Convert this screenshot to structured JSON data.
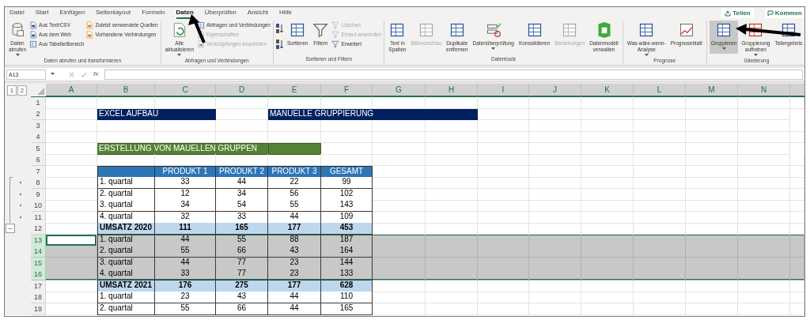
{
  "ribbon_tabs": [
    {
      "label": "Datei",
      "selected": false
    },
    {
      "label": "Start",
      "selected": false
    },
    {
      "label": "Einfügen",
      "selected": false
    },
    {
      "label": "Seitenlayout",
      "selected": false
    },
    {
      "label": "Formeln",
      "selected": false
    },
    {
      "label": "Daten",
      "selected": true
    },
    {
      "label": "Überprüfen",
      "selected": false
    },
    {
      "label": "Ansicht",
      "selected": false
    },
    {
      "label": "Hilfe",
      "selected": false
    }
  ],
  "share_button": "Teilen",
  "comments_button": "Kommen",
  "ribbon_groups": [
    {
      "label": "Daten abrufen und transformieren",
      "columns": [
        {
          "kind": "large",
          "label": "Daten\nabrufen",
          "dropdown": true,
          "disabled": false,
          "selected": false
        },
        {
          "kind": "stack",
          "items": [
            {
              "label": "Aus Text/CSV",
              "disabled": false
            },
            {
              "label": "Aus dem Web",
              "disabled": false
            },
            {
              "label": "Aus Tabelle/Bereich",
              "disabled": false
            }
          ]
        },
        {
          "kind": "stack",
          "items": [
            {
              "label": "Zuletzt verwendete Quellen",
              "disabled": false
            },
            {
              "label": "Vorhandene Verbindungen",
              "disabled": false
            }
          ]
        }
      ]
    },
    {
      "label": "Abfragen und Verbindungen",
      "columns": [
        {
          "kind": "large",
          "label": "Alle\naktualisieren",
          "dropdown": true,
          "disabled": false,
          "selected": false
        },
        {
          "kind": "stack",
          "items": [
            {
              "label": "Abfragen und Verbindungen",
              "disabled": false
            },
            {
              "label": "Eigenschaften",
              "disabled": true
            },
            {
              "label": "Verknüpfungen bearbeiten",
              "disabled": true
            }
          ]
        }
      ]
    },
    {
      "label": "Sortieren und Filtern",
      "columns": [
        {
          "kind": "sort_buttons"
        },
        {
          "kind": "large",
          "label": "Sortieren",
          "dropdown": false,
          "disabled": false,
          "selected": false
        },
        {
          "kind": "large",
          "label": "Filtern",
          "dropdown": false,
          "disabled": false,
          "selected": false
        },
        {
          "kind": "stack",
          "items": [
            {
              "label": "Löschen",
              "disabled": true
            },
            {
              "label": "Erneut anwenden",
              "disabled": true
            },
            {
              "label": "Erweitert",
              "disabled": false
            }
          ]
        }
      ]
    },
    {
      "label": "Datentools",
      "columns": [
        {
          "kind": "large",
          "label": "Text in\nSpalten",
          "dropdown": false,
          "disabled": false,
          "selected": false
        },
        {
          "kind": "large",
          "label": "Blitzvorschau",
          "dropdown": false,
          "disabled": true,
          "selected": false
        },
        {
          "kind": "large",
          "label": "Duplikate\nentfernen",
          "dropdown": false,
          "disabled": false,
          "selected": false
        },
        {
          "kind": "large",
          "label": "Datenüberprüfung",
          "dropdown": true,
          "disabled": false,
          "selected": false
        },
        {
          "kind": "large",
          "label": "Konsolidieren",
          "dropdown": false,
          "disabled": false,
          "selected": false
        },
        {
          "kind": "large",
          "label": "Beziehungen",
          "dropdown": false,
          "disabled": true,
          "selected": false
        },
        {
          "kind": "large",
          "label": "Datenmodell\nverwalten",
          "dropdown": false,
          "disabled": false,
          "selected": false
        }
      ]
    },
    {
      "label": "Prognose",
      "columns": [
        {
          "kind": "large",
          "label": "Was-wäre-wenn-\nAnalyse",
          "dropdown": true,
          "disabled": false,
          "selected": false
        },
        {
          "kind": "large",
          "label": "Prognoseblatt",
          "dropdown": false,
          "disabled": false,
          "selected": false
        }
      ]
    },
    {
      "label": "Gliederung",
      "columns": [
        {
          "kind": "large",
          "label": "Gruppieren",
          "dropdown": true,
          "disabled": false,
          "selected": true
        },
        {
          "kind": "large",
          "label": "Gruppierung\naufheben",
          "dropdown": true,
          "disabled": false,
          "selected": false
        },
        {
          "kind": "large",
          "label": "Teilergebnis",
          "dropdown": false,
          "disabled": false,
          "selected": false
        }
      ]
    }
  ],
  "name_box": "A13",
  "function_label": "fx",
  "outline_levels": [
    "1",
    "2"
  ],
  "columns": [
    {
      "label": "A",
      "selected": true
    },
    {
      "label": "B",
      "selected": true
    },
    {
      "label": "C",
      "selected": true
    },
    {
      "label": "D",
      "selected": true
    },
    {
      "label": "E",
      "selected": true
    },
    {
      "label": "F",
      "selected": true
    },
    {
      "label": "G",
      "selected": true
    },
    {
      "label": "H",
      "selected": true
    },
    {
      "label": "I",
      "selected": true
    },
    {
      "label": "J",
      "selected": true
    },
    {
      "label": "K",
      "selected": true
    },
    {
      "label": "L",
      "selected": true
    },
    {
      "label": "M",
      "selected": true
    },
    {
      "label": "N",
      "selected": true
    }
  ],
  "rows": [
    {
      "number": "1",
      "kind": "blank",
      "selected": false,
      "active": false,
      "grouped": false
    },
    {
      "number": "2",
      "kind": "banners",
      "selected": false,
      "active": false,
      "grouped": false,
      "banners": [
        "EXCEL AUFBAU",
        "MANUELLE GRUPPIERUNG"
      ]
    },
    {
      "number": "3",
      "kind": "blank",
      "selected": false,
      "active": false,
      "grouped": false
    },
    {
      "number": "4",
      "kind": "blank",
      "selected": false,
      "active": false,
      "grouped": false
    },
    {
      "number": "5",
      "kind": "section",
      "selected": false,
      "active": false,
      "grouped": false,
      "label": "ERSTELLUNG VON MAUELLEN GRUPPEN"
    },
    {
      "number": "6",
      "kind": "blank",
      "selected": false,
      "active": false,
      "grouped": false
    },
    {
      "number": "7",
      "kind": "table_header",
      "selected": false,
      "active": false,
      "grouped": false,
      "values": [
        "PRODUKT 1",
        "PRODUKT 2",
        "PRODUKT 3",
        "GESAMT"
      ]
    },
    {
      "number": "8",
      "kind": "data",
      "selected": false,
      "active": false,
      "grouped": true,
      "label": "1. quartal",
      "values": [
        "33",
        "44",
        "22",
        "99"
      ]
    },
    {
      "number": "9",
      "kind": "data",
      "selected": false,
      "active": false,
      "grouped": true,
      "label": "2. quartal",
      "values": [
        "12",
        "34",
        "56",
        "102"
      ]
    },
    {
      "number": "10",
      "kind": "data",
      "selected": false,
      "active": false,
      "grouped": true,
      "label": "3. quartal",
      "values": [
        "34",
        "54",
        "55",
        "143"
      ]
    },
    {
      "number": "11",
      "kind": "data",
      "selected": false,
      "active": false,
      "grouped": true,
      "label": "4. quartal",
      "values": [
        "32",
        "33",
        "44",
        "109"
      ]
    },
    {
      "number": "12",
      "kind": "total",
      "selected": false,
      "active": false,
      "grouped": false,
      "outline_button": "−",
      "label": "UMSATZ 2020",
      "values": [
        "111",
        "165",
        "177",
        "453"
      ]
    },
    {
      "number": "13",
      "kind": "data",
      "selected": true,
      "active": true,
      "grouped": false,
      "label": "1. quartal",
      "values": [
        "44",
        "55",
        "88",
        "187"
      ]
    },
    {
      "number": "14",
      "kind": "data",
      "selected": true,
      "active": false,
      "grouped": false,
      "label": "2. quartal",
      "values": [
        "55",
        "66",
        "43",
        "164"
      ]
    },
    {
      "number": "15",
      "kind": "data",
      "selected": true,
      "active": false,
      "grouped": false,
      "label": "3. quartal",
      "values": [
        "44",
        "77",
        "23",
        "144"
      ]
    },
    {
      "number": "16",
      "kind": "data",
      "selected": true,
      "active": false,
      "grouped": false,
      "label": "4. quartal",
      "values": [
        "33",
        "77",
        "23",
        "133"
      ]
    },
    {
      "number": "17",
      "kind": "total",
      "selected": false,
      "active": false,
      "grouped": false,
      "label": "UMSATZ 2021",
      "values": [
        "176",
        "275",
        "177",
        "628"
      ]
    },
    {
      "number": "18",
      "kind": "data",
      "selected": false,
      "active": false,
      "grouped": false,
      "label": "1. quartal",
      "values": [
        "23",
        "43",
        "44",
        "110"
      ]
    },
    {
      "number": "19",
      "kind": "data",
      "selected": false,
      "active": false,
      "grouped": false,
      "label": "2. quartal",
      "values": [
        "55",
        "66",
        "44",
        "165"
      ]
    }
  ]
}
